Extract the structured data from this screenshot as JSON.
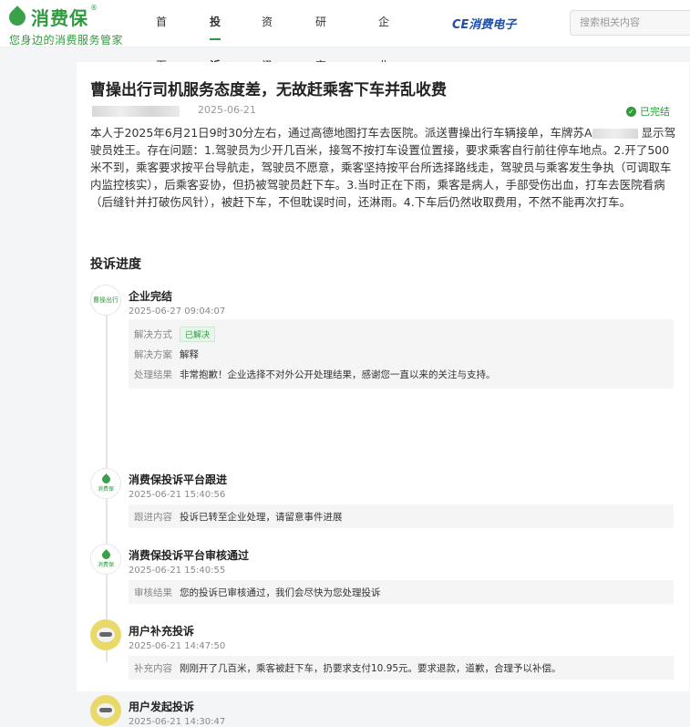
{
  "header": {
    "logo_name": "消费保",
    "logo_reg": "®",
    "slogan": "您身边的消费服务管家",
    "nav": [
      {
        "label": "首页"
      },
      {
        "label": "投诉"
      },
      {
        "label": "资讯"
      },
      {
        "label": "研究院"
      },
      {
        "label": "企业服务"
      }
    ],
    "active_nav": "投诉",
    "brand_link": "CE消费电子",
    "search_placeholder": "搜索相关内容"
  },
  "complaint": {
    "title": "曹操出行司机服务态度差，无故赶乘客下车并乱收费",
    "date": "2025-06-21",
    "status": "已完结",
    "body_part1": "本人于2025年6月21日9时30分左右，通过高德地图打车去医院。派送曹操出行车辆接单，车牌苏A",
    "body_part2": "显示驾驶员姓王。存在问题：1.驾驶员为少开几百米，接驾不按打车设置位置接，要求乘客自行前往停车地点。2.开了500米不到，乘客要求按平台导航走，驾驶员不愿意，乘客坚持按平台所选择路线走，驾驶员与乘客发生争执（可调取车内监控核实），后乘客妥协，但扔被驾驶员赶下车。3.当时正在下雨，乘客是病人，手部受伤出血，打车去医院看病（后缝针并打破伤风针），被赶下车，不但耽误时间，还淋雨。4.下车后仍然收取费用，不然不能再次打车。"
  },
  "progress": {
    "title": "投诉进度",
    "items": [
      {
        "head": "企业完结",
        "time": "2025-06-27 09:04:07",
        "avatar_text": "曹操出行",
        "rows": [
          {
            "label": "解决方式",
            "value": "已解决"
          },
          {
            "label": "解决方案",
            "value": "解释"
          },
          {
            "label": "处理结果",
            "value": "非常抱歉！企业选择不对外公开处理结果，感谢您一直以来的关注与支持。"
          }
        ]
      },
      {
        "head": "消费保投诉平台跟进",
        "time": "2025-06-21 15:40:56",
        "avatar_text": "消费保",
        "rows": [
          {
            "label": "跟进内容",
            "value": "投诉已转至企业处理，请留意事件进展"
          }
        ]
      },
      {
        "head": "消费保投诉平台审核通过",
        "time": "2025-06-21 15:40:55",
        "avatar_text": "消费保",
        "rows": [
          {
            "label": "审核结果",
            "value": "您的投诉已审核通过，我们会尽快为您处理投诉"
          }
        ]
      },
      {
        "head": "用户补充投诉",
        "time": "2025-06-21 14:47:50",
        "rows": [
          {
            "label": "补充内容",
            "value": "刚刚开了几百米，乘客被赶下车，扔要求支付10.95元。要求退款，道歉，合理予以补偿。"
          }
        ]
      },
      {
        "head": "用户发起投诉",
        "time": "2025-06-21 14:30:47"
      }
    ]
  }
}
